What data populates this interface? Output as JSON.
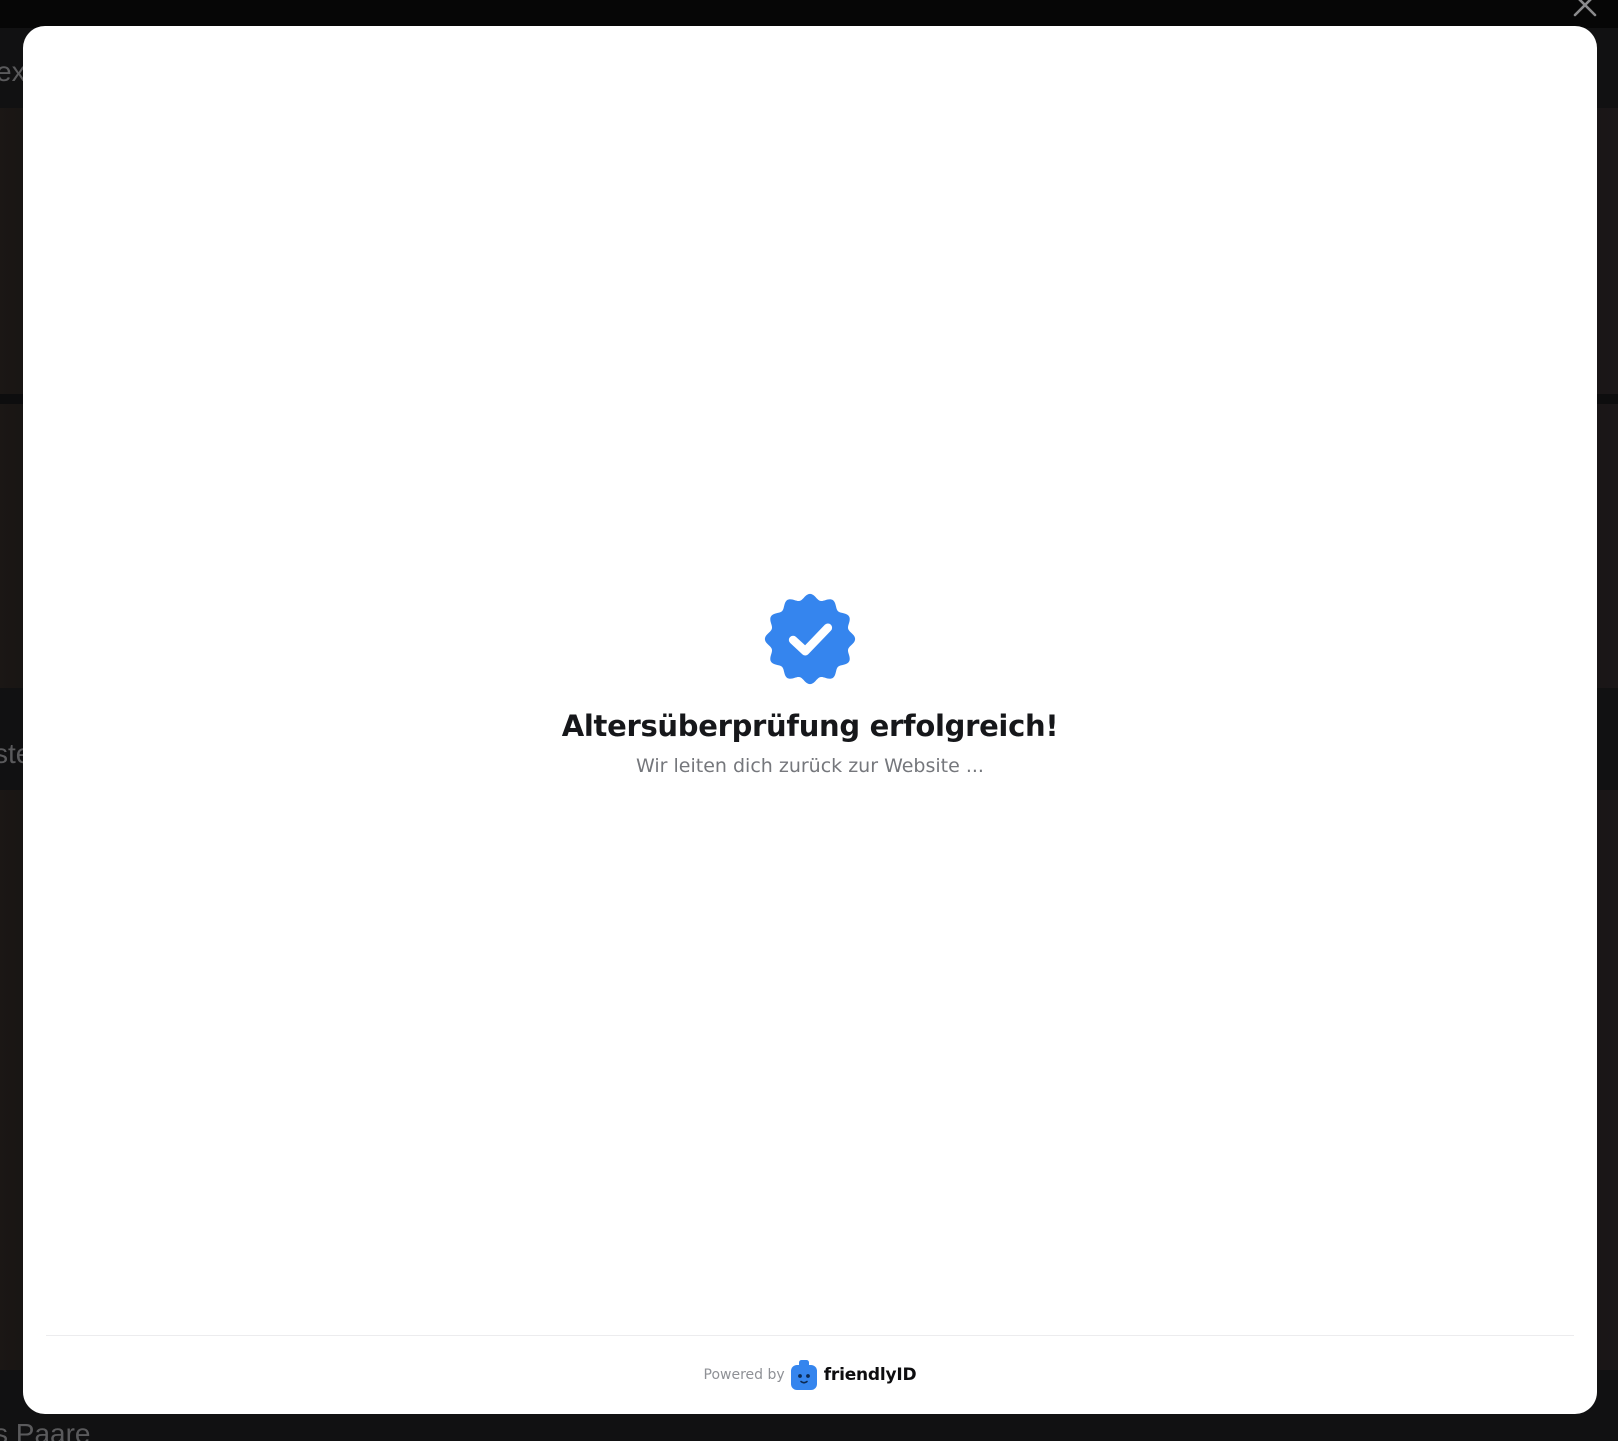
{
  "background": {
    "fragments": [
      "ex",
      "ste",
      "s Paare"
    ],
    "close_icon": "close-icon"
  },
  "modal": {
    "badge_icon": "verified-badge-icon",
    "title": "Altersüberprüfung erfolgreich!",
    "subtitle": "Wir leiten dich zurück zur Website ...",
    "footer": {
      "powered_by": "Powered by",
      "brand": "friendlyID",
      "logo_icon": "friendlyid-logo-icon"
    }
  },
  "colors": {
    "accent": "#3585ee",
    "title": "#16171a",
    "subtitle": "#75777c",
    "overlay": "#0d0d0e"
  }
}
